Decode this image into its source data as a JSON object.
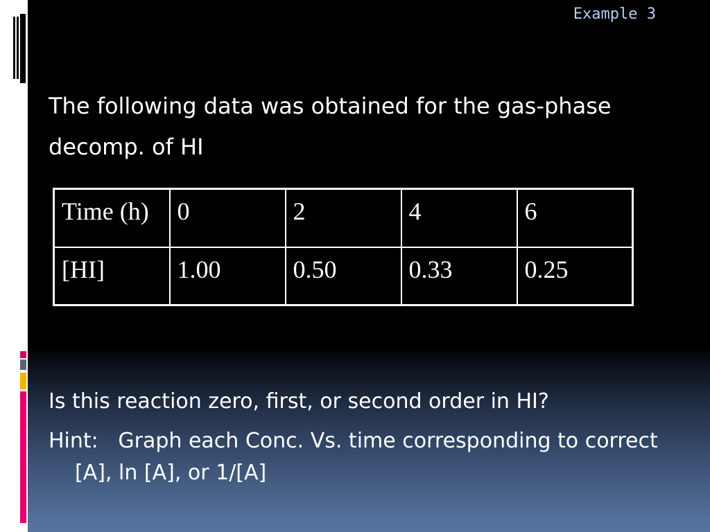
{
  "slide": {
    "title": "Example 3"
  },
  "intro": {
    "text": "The following data was obtained for the gas-phase decomp. of HI"
  },
  "table": {
    "rows": [
      [
        "Time (h)",
        "0",
        "2",
        "4",
        "6"
      ],
      [
        "[HI]",
        "1.00",
        "0.50",
        "0.33",
        "0.25"
      ]
    ]
  },
  "question": {
    "text": "Is this reaction zero, first, or second order in HI?"
  },
  "hint": {
    "text": "Hint:   Graph each Conc. Vs. time corresponding to correct [A], ln [A], or 1/[A]"
  },
  "colors": {
    "title_text": "#b7cdf0",
    "body_text": "#ffffff",
    "background_top": "#000000",
    "background_bottom": "#58749e",
    "accent_red": "#d90057",
    "accent_gray": "#5b6470",
    "accent_yellow": "#f2b400",
    "accent_pink": "#e8006c"
  }
}
